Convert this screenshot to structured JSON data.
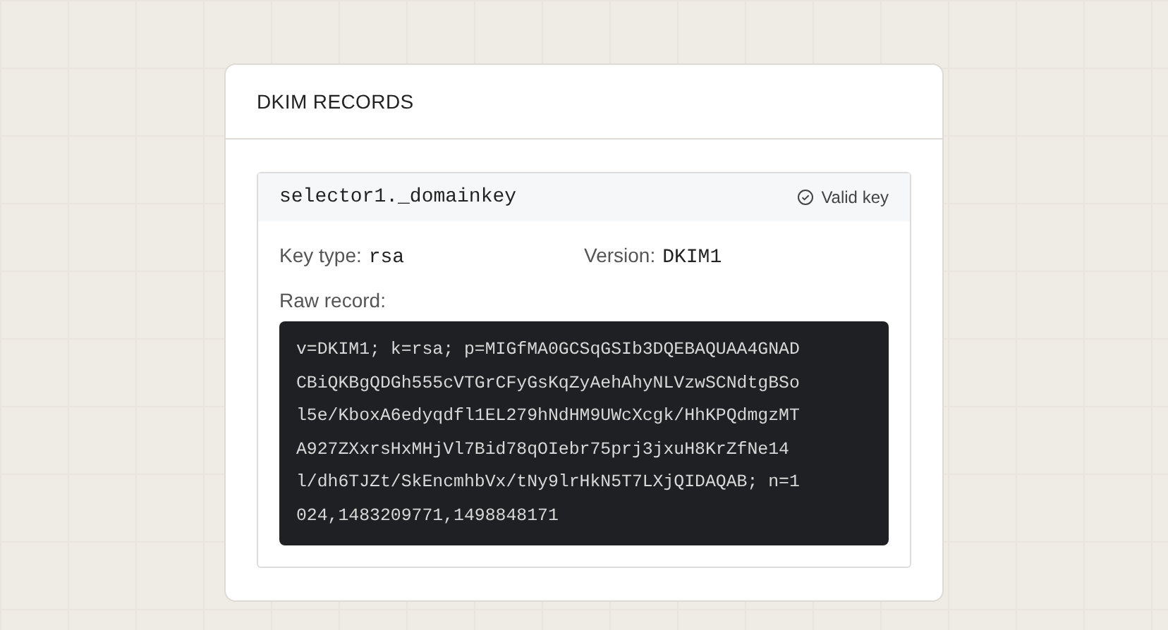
{
  "card": {
    "title": "DKIM RECORDS"
  },
  "record": {
    "selector": "selector1._domainkey",
    "status": {
      "valid": true,
      "label": "Valid key"
    },
    "key_type": {
      "label": "Key type:",
      "value": "rsa"
    },
    "version": {
      "label": "Version:",
      "value": "DKIM1"
    },
    "raw_label": "Raw record:",
    "raw": "v=DKIM1; k=rsa; p=MIGfMA0GCSqGSIb3DQEBAQUAA4GNADCBiQKBgQDGh555cVTGrCFyGsKqZyAehAhyNLVzwSCNdtgBSol5e/KboxA6edyqdfl1EL279hNdHM9UWcXcgk/HhKPQdmgzMTA927ZXxrsHxMHjVl7Bid78qOIebr75prj3jxuH8KrZfNe14l/dh6TJZt/SkEncmhbVx/tNy9lrHkN5T7LXjQIDAQAB; n=1024,1483209771,1498848171"
  }
}
